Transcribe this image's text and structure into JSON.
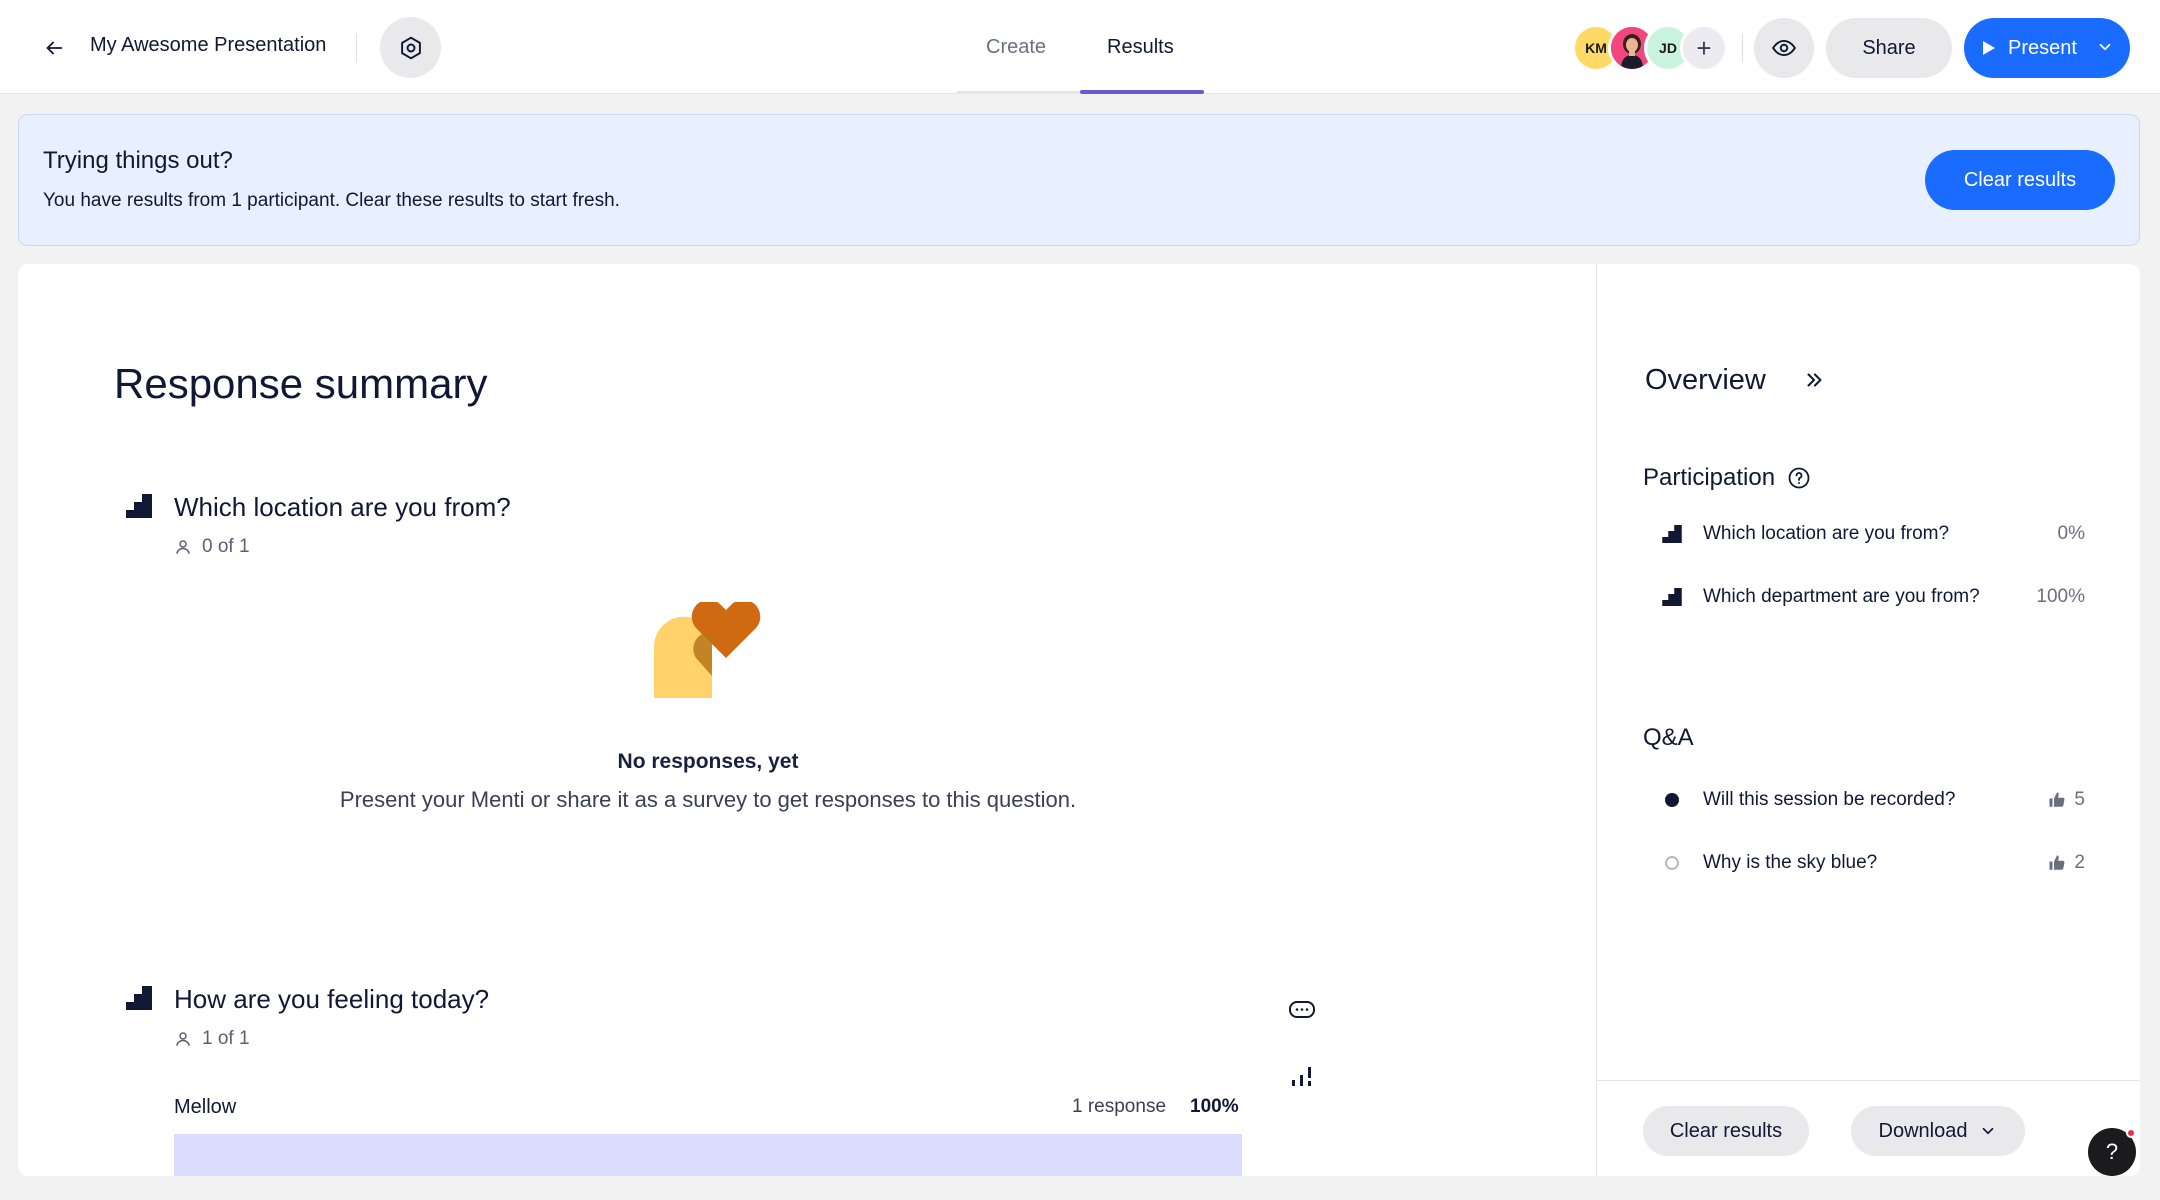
{
  "header": {
    "presentation_title": "My Awesome Presentation",
    "tabs": [
      {
        "label": "Create",
        "active": false
      },
      {
        "label": "Results",
        "active": true
      }
    ],
    "avatars": [
      {
        "initials": "KM",
        "color": "#ffd966"
      },
      {
        "initials": "",
        "color": "#f2467d",
        "kind": "photo"
      },
      {
        "initials": "JD",
        "color": "#c9f3dd"
      }
    ],
    "add_collaborator": "+",
    "share_label": "Share",
    "present_label": "Present",
    "accent_color": "#196cff"
  },
  "banner": {
    "title": "Trying things out?",
    "text": "You have results from 1 participant. Clear these results to start fresh.",
    "button_label": "Clear results"
  },
  "summary": {
    "title": "Response summary",
    "questions": [
      {
        "title": "Which location are you from?",
        "count": "0 of 1",
        "empty_title": "No responses, yet",
        "empty_text": "Present your Menti or share it as a survey to get responses to this question."
      },
      {
        "title": "How are you feeling today?",
        "count": "1 of 1",
        "results": [
          {
            "label": "Mellow",
            "responses": "1 response",
            "percent": "100%",
            "fraction": 1.0
          }
        ]
      }
    ]
  },
  "overview": {
    "title": "Overview",
    "participation_title": "Participation",
    "participation": [
      {
        "label": "Which location are you from?",
        "value": "0%"
      },
      {
        "label": "Which department are you from?",
        "value": "100%"
      }
    ],
    "qa_title": "Q&A",
    "qa": [
      {
        "label": "Will this session be recorded?",
        "votes": "5",
        "answered": true
      },
      {
        "label": "Why is the sky blue?",
        "votes": "2",
        "answered": false
      }
    ],
    "footer": {
      "clear_label": "Clear results",
      "download_label": "Download"
    }
  },
  "help_fab": "?"
}
